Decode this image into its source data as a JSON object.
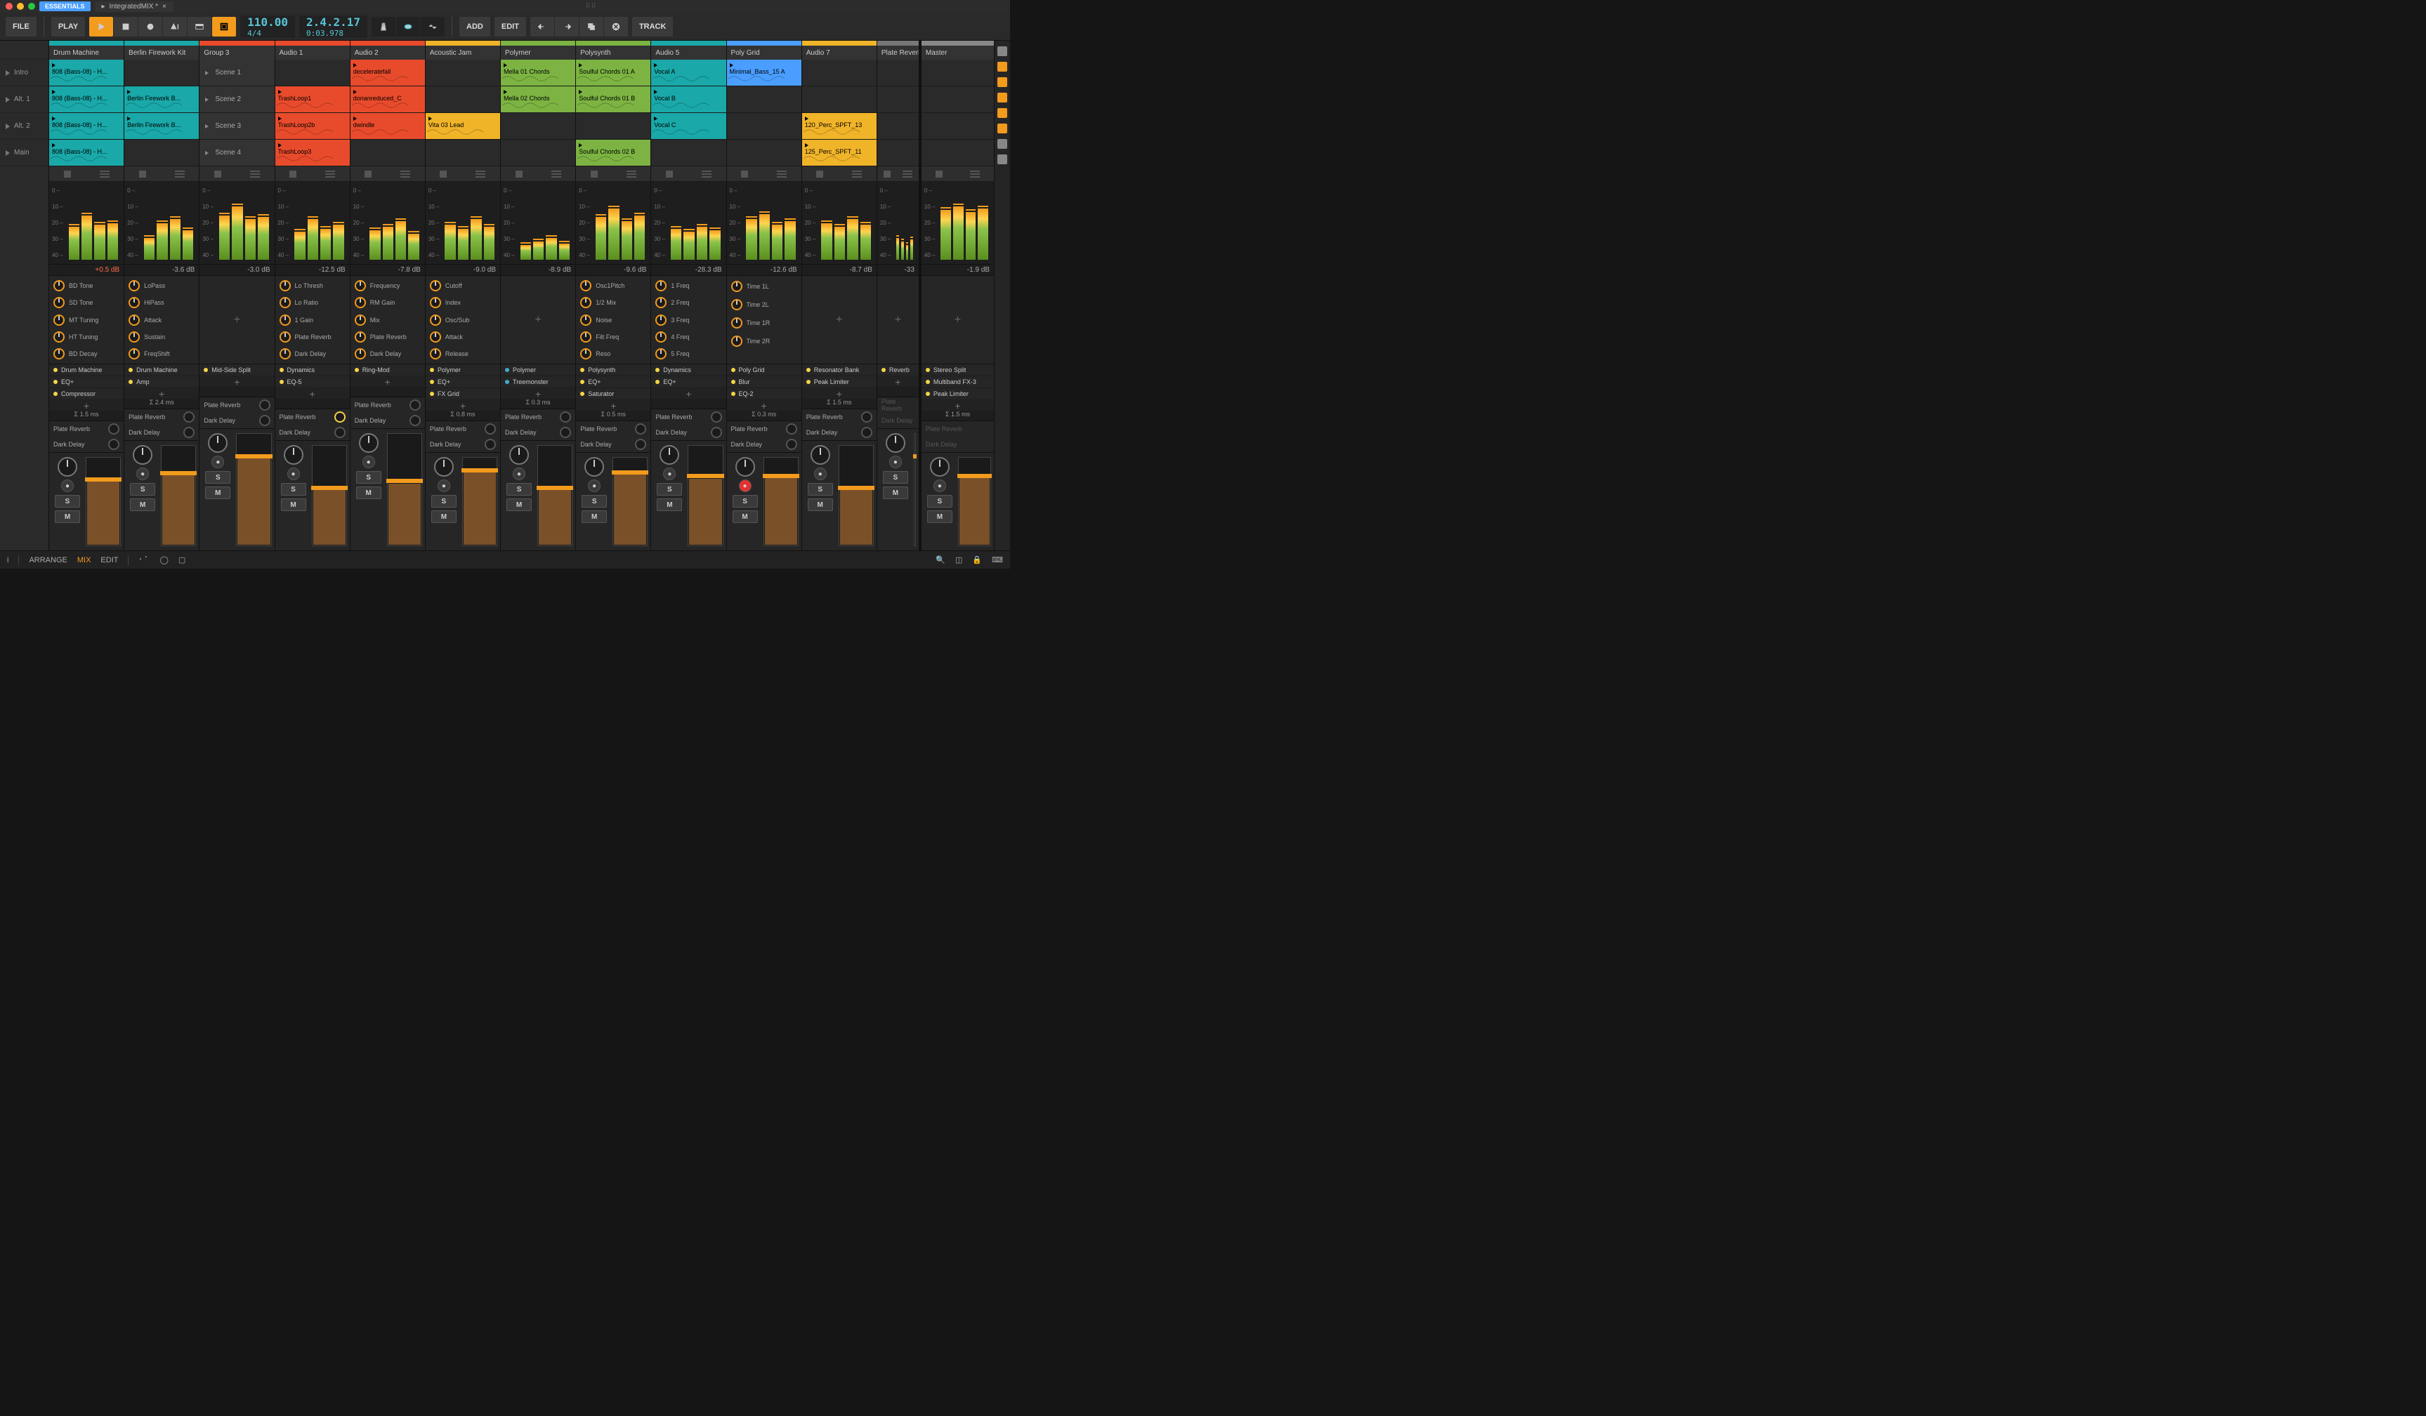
{
  "titlebar": {
    "badge": "ESSENTIALS",
    "doc": "IntegratedMIX *"
  },
  "transport": {
    "file": "FILE",
    "play": "PLAY",
    "add": "ADD",
    "edit": "EDIT",
    "track": "TRACK",
    "tempo": "110.00",
    "sig": "4/4",
    "pos": "2.4.2.17",
    "time": "0:03.978"
  },
  "scenes": [
    "Intro",
    "Alt. 1",
    "Alt. 2",
    "Main"
  ],
  "scale": [
    "0",
    "10",
    "20",
    "30",
    "40"
  ],
  "sendNames": [
    "Plate Reverb",
    "Dark Delay"
  ],
  "buttons": {
    "solo": "S",
    "mute": "M"
  },
  "footer": {
    "arrange": "ARRANGE",
    "mix": "MIX",
    "edit": "EDIT",
    "info": "i"
  },
  "tracks": [
    {
      "name": "Drum Machine",
      "color": "#1aa8a8",
      "clips": [
        {
          "t": "808 (Bass-08) - H...",
          "c": "#1aa8a8"
        },
        {
          "t": "808 (Bass-08) - H...",
          "c": "#1aa8a8"
        },
        {
          "t": "808 (Bass-08) - H...",
          "c": "#1aa8a8"
        },
        {
          "t": "808 (Bass-08) - H...",
          "c": "#1aa8a8"
        }
      ],
      "db": "+0.5 dB",
      "hot": true,
      "bars": [
        45,
        60,
        48,
        50
      ],
      "knobs": [
        "BD Tone",
        "SD Tone",
        "MT Tuning",
        "HT Tuning",
        "BD Decay"
      ],
      "devs": [
        {
          "n": "Drum Machine",
          "d": "y"
        },
        {
          "n": "EQ+",
          "d": "y"
        },
        {
          "n": "Compressor",
          "d": "y"
        }
      ],
      "sigma": "Σ 1.5 ms",
      "sends": [
        false,
        false
      ],
      "fader": {
        "pos": 22,
        "fill": 72,
        "val": "-2.7"
      }
    },
    {
      "name": "Berlin Firework Kit",
      "color": "#1aa8a8",
      "clips": [
        null,
        {
          "t": "Berlin Firework B...",
          "c": "#1aa8a8"
        },
        {
          "t": "Berlin Firework B...",
          "c": "#1aa8a8"
        },
        null
      ],
      "db": "-3.6 dB",
      "bars": [
        30,
        50,
        55,
        40
      ],
      "knobs": [
        "LoPass",
        "HiPass",
        "Attack",
        "Sustain",
        "FreqShift"
      ],
      "devs": [
        {
          "n": "Drum Machine",
          "d": "y"
        },
        {
          "n": "Amp",
          "d": "y"
        }
      ],
      "sigma": "Σ 2.4 ms",
      "sends": [
        false,
        false
      ],
      "fader": {
        "pos": 25,
        "fill": 70,
        "val": "-3.2"
      }
    },
    {
      "name": "Group 3",
      "color": "#e84b2c",
      "clips": [
        "scene",
        "scene",
        "scene",
        "scene"
      ],
      "sceneLabels": [
        "Scene 1",
        "Scene 2",
        "Scene 3",
        "Scene 4"
      ],
      "db": "-3.0 dB",
      "bars": [
        60,
        72,
        55,
        58
      ],
      "knobs": [],
      "devs": [
        {
          "n": "Mid-Side Split",
          "d": "y"
        }
      ],
      "sigma": "",
      "sends": [
        false,
        false
      ],
      "fader": {
        "pos": 18,
        "fill": 78,
        "val": "0.0"
      }
    },
    {
      "name": "Audio 1",
      "color": "#e84b2c",
      "clips": [
        null,
        {
          "t": "TrashLoop1",
          "c": "#e84b2c"
        },
        {
          "t": "TrashLoop2b",
          "c": "#e84b2c"
        },
        {
          "t": "TrashLoop3",
          "c": "#e84b2c"
        }
      ],
      "db": "-12.5 dB",
      "bars": [
        38,
        55,
        42,
        48
      ],
      "knobs": [
        "Lo Thresh",
        "Lo Ratio",
        "1 Gain",
        "Plate Reverb",
        "Dark Delay"
      ],
      "devs": [
        {
          "n": "Dynamics",
          "d": "y"
        },
        {
          "n": "EQ-5",
          "d": "y"
        }
      ],
      "sigma": "",
      "sends": [
        true,
        false
      ],
      "fader": {
        "pos": 40,
        "fill": 55,
        "val": "-10.0"
      }
    },
    {
      "name": "Audio 2",
      "color": "#e84b2c",
      "clips": [
        {
          "t": "deceleratefall",
          "c": "#e84b2c"
        },
        {
          "t": "dorianreduced_C",
          "c": "#e84b2c"
        },
        {
          "t": "dwindle",
          "c": "#e84b2c"
        },
        null
      ],
      "db": "-7.8 dB",
      "bars": [
        40,
        45,
        52,
        35
      ],
      "knobs": [
        "Frequency",
        "RM Gain",
        "Mix",
        "Plate Reverb",
        "Dark Delay"
      ],
      "devs": [
        {
          "n": "Ring-Mod",
          "d": "y"
        }
      ],
      "sigma": "",
      "sends": [
        false,
        false
      ],
      "fader": {
        "pos": 40,
        "fill": 55,
        "val": "-10.0"
      }
    },
    {
      "name": "Acoustic Jam",
      "color": "#f0b429",
      "clips": [
        null,
        null,
        {
          "t": "Vita 03 Lead",
          "c": "#f0b429"
        },
        null
      ],
      "db": "-9.0 dB",
      "bars": [
        48,
        42,
        55,
        45
      ],
      "knobs": [
        "Cutoff",
        "Index",
        "Osc/Sub",
        "Attack",
        "Release"
      ],
      "devs": [
        {
          "n": "Polymer",
          "d": "y"
        },
        {
          "n": "EQ+",
          "d": "y"
        },
        {
          "n": "FX Grid",
          "d": "y"
        }
      ],
      "sigma": "Σ 0.8 ms",
      "sends": [
        false,
        false
      ],
      "fader": {
        "pos": 12,
        "fill": 84,
        "val": "+3.3"
      }
    },
    {
      "name": "Polymer",
      "color": "#7cb342",
      "clips": [
        {
          "t": "Mella 01 Chords",
          "c": "#7cb342"
        },
        {
          "t": "Mella 02 Chords",
          "c": "#7cb342"
        },
        null,
        null
      ],
      "db": "-8.9 dB",
      "bars": [
        20,
        25,
        30,
        22
      ],
      "knobs": [],
      "devs": [
        {
          "n": "Polymer",
          "d": "c"
        },
        {
          "n": "Treemonster",
          "d": "c"
        }
      ],
      "sigma": "Σ 0.3 ms",
      "sends": [
        false,
        false
      ],
      "fader": {
        "pos": 40,
        "fill": 55,
        "val": "-10.0"
      }
    },
    {
      "name": "Polysynth",
      "color": "#7cb342",
      "clips": [
        {
          "t": "Soulful Chords 01 A",
          "c": "#7cb342"
        },
        {
          "t": "Soulful Chords 01 B",
          "c": "#7cb342"
        },
        null,
        {
          "t": "Soulful Chords 02 B",
          "c": "#7cb342"
        }
      ],
      "db": "-9.6 dB",
      "bars": [
        58,
        70,
        52,
        60
      ],
      "knobs": [
        "Osc1Pitch",
        "1/2 Mix",
        "Noise",
        "Filt Freq",
        "Reso"
      ],
      "devs": [
        {
          "n": "Polysynth",
          "d": "y"
        },
        {
          "n": "EQ+",
          "d": "y"
        },
        {
          "n": "Saturator",
          "d": "y"
        }
      ],
      "sigma": "Σ 0.5 ms",
      "sends": [
        false,
        false
      ],
      "fader": {
        "pos": 14,
        "fill": 82,
        "val": "+2.0"
      }
    },
    {
      "name": "Audio 5",
      "color": "#1aa8a8",
      "clips": [
        {
          "t": "Vocal A",
          "c": "#1aa8a8"
        },
        {
          "t": "Vocal B",
          "c": "#1aa8a8"
        },
        {
          "t": "Vocal C",
          "c": "#1aa8a8"
        },
        null
      ],
      "db": "-28.3 dB",
      "bars": [
        42,
        38,
        45,
        40
      ],
      "knobs": [
        "1 Freq",
        "2 Freq",
        "3 Freq",
        "4 Freq",
        "5 Freq"
      ],
      "devs": [
        {
          "n": "Dynamics",
          "d": "y"
        },
        {
          "n": "EQ+",
          "d": "y"
        }
      ],
      "sigma": "",
      "sends": [
        false,
        false
      ],
      "fader": {
        "pos": 28,
        "fill": 66,
        "val": "-4.4"
      }
    },
    {
      "name": "Poly Grid",
      "color": "#4a9eff",
      "clips": [
        {
          "t": "Minimal_Bass_15 A",
          "c": "#4a9eff"
        },
        null,
        null,
        null
      ],
      "db": "-12.6 dB",
      "bars": [
        55,
        62,
        48,
        52
      ],
      "knobs": [
        "Time 1L",
        "Time 2L",
        "Time 1R",
        "Time 2R"
      ],
      "devs": [
        {
          "n": "Poly Grid",
          "d": "y"
        },
        {
          "n": "Blur",
          "d": "y"
        },
        {
          "n": "EQ-2",
          "d": "y"
        }
      ],
      "sigma": "Σ 0.3 ms",
      "sends": [
        false,
        false
      ],
      "fader": {
        "pos": 18,
        "fill": 78,
        "val": "0.0"
      },
      "recOn": true
    },
    {
      "name": "Audio 7",
      "color": "#f0b429",
      "clips": [
        null,
        null,
        {
          "t": "120_Perc_SPFT_13",
          "c": "#f0b429"
        },
        {
          "t": "125_Perc_SPFT_11",
          "c": "#f0b429"
        }
      ],
      "db": "-8.7 dB",
      "bars": [
        50,
        45,
        55,
        48
      ],
      "knobs": [],
      "devs": [
        {
          "n": "Resonator Bank",
          "d": "y"
        },
        {
          "n": "Peak Limiter",
          "d": "y"
        }
      ],
      "sigma": "Σ 1.5 ms",
      "sends": [
        false,
        false
      ],
      "fader": {
        "pos": 40,
        "fill": 55,
        "val": "-10.0"
      }
    },
    {
      "name": "Plate Reverb",
      "color": "#777",
      "clips": [
        null,
        null,
        null,
        null
      ],
      "db": "-33",
      "bars": [
        30,
        25,
        20,
        28
      ],
      "knobs": [],
      "devs": [
        {
          "n": "Reverb",
          "d": "y"
        }
      ],
      "sigma": "",
      "sends": [],
      "fader": {
        "pos": 18,
        "fill": 78,
        "val": ""
      },
      "narrow": true
    },
    {
      "name": "Master",
      "color": "#888",
      "clips": [
        null,
        null,
        null,
        null
      ],
      "db": "-1.9 dB",
      "bars": [
        68,
        72,
        65,
        70
      ],
      "knobs": [],
      "devs": [
        {
          "n": "Stereo Split",
          "d": "y"
        },
        {
          "n": "Multiband FX-3",
          "d": "y"
        },
        {
          "n": "Peak Limiter",
          "d": "y"
        }
      ],
      "sigma": "Σ 1.5 ms",
      "sends": [],
      "fader": {
        "pos": 18,
        "fill": 78,
        "val": ""
      },
      "master": true
    }
  ]
}
